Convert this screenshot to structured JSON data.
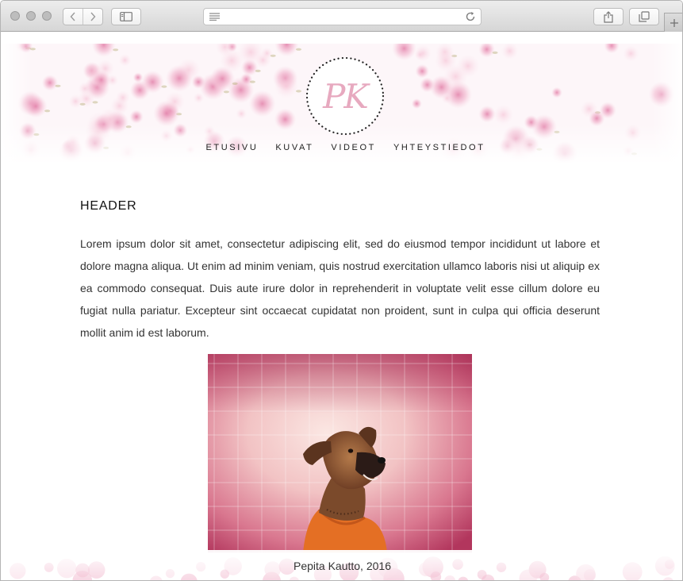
{
  "browser": {
    "address_value": "",
    "address_placeholder": "",
    "colors": {
      "toolbar": "#dedede",
      "border": "#a9a9a9"
    }
  },
  "site": {
    "logo_text": "PK",
    "nav": [
      "ETUSIVU",
      "KUVAT",
      "VIDEOT",
      "YHTEYSTIEDOT"
    ],
    "colors": {
      "accent_pink": "#e7a9bf",
      "text": "#333333"
    }
  },
  "article": {
    "header": "HEADER",
    "body": "Lorem ipsum dolor sit amet, consectetur adipiscing elit, sed do eiusmod tempor incididunt ut labore et dolore magna aliqua. Ut enim ad minim veniam, quis nostrud exercitation ullamco laboris nisi ut aliquip ex ea commodo consequat. Duis aute irure dolor in reprehenderit in voluptate velit esse cillum dolore eu fugiat nulla pariatur. Excepteur sint occaecat cupidatat non proident, sunt in culpa qui officia deserunt mollit anim id est laborum.",
    "caption": "Pepita Kautto, 2016"
  },
  "icons": {
    "back": "chevron-left-icon",
    "forward": "chevron-right-icon",
    "sidebar": "sidebar-icon",
    "reader": "reader-icon",
    "reload": "reload-icon",
    "share": "share-icon",
    "tabs": "tabs-icon",
    "new_tab": "plus-icon"
  }
}
